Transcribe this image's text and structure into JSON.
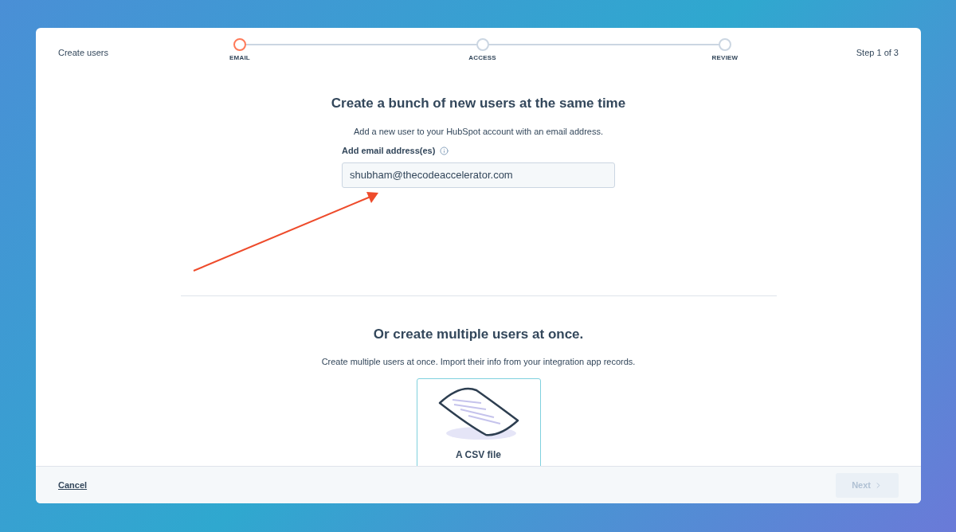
{
  "header": {
    "title": "Create users",
    "step_counter": "Step 1 of 3"
  },
  "steps": [
    {
      "label": "EMAIL",
      "selected": true
    },
    {
      "label": "ACCESS",
      "selected": false
    },
    {
      "label": "REVIEW",
      "selected": false
    }
  ],
  "single": {
    "heading": "Create a bunch of new users at the same time",
    "description": "Add a new user to your HubSpot account with an email address.",
    "field_label": "Add email address(es)",
    "value": "shubham@thecodeaccelerator.com"
  },
  "multiple": {
    "heading": "Or create multiple users at once.",
    "description": "Create multiple users at once. Import their info from your integration app records.",
    "options": [
      {
        "label": "A CSV file"
      }
    ]
  },
  "footer": {
    "cancel": "Cancel",
    "next": {
      "label": "Next",
      "disabled": true
    }
  }
}
